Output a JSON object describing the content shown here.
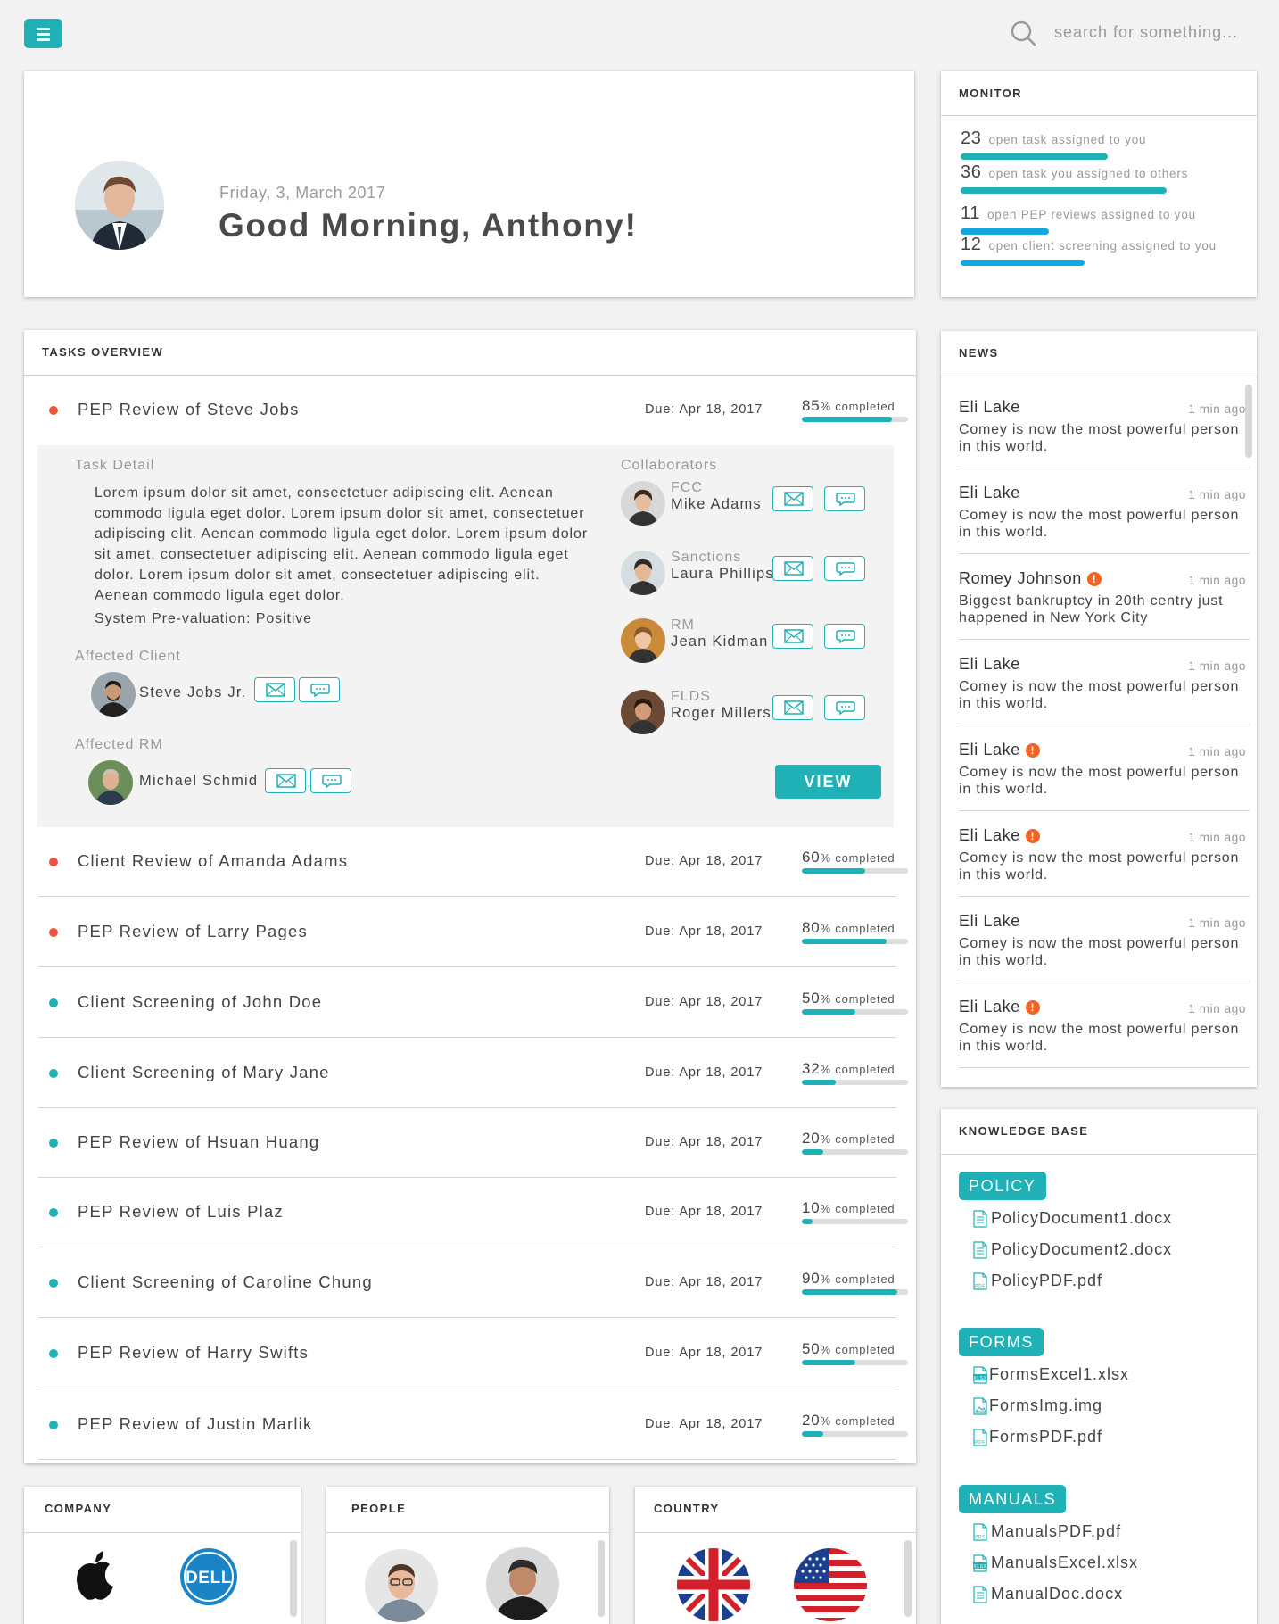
{
  "topbar": {
    "search_placeholder": "search for something..."
  },
  "welcome": {
    "date": "Friday, 3, March 2017",
    "greeting": "Good Morning, Anthony!"
  },
  "monitor": {
    "title": "MONITOR",
    "rows": [
      {
        "count": "23",
        "label": "open task assigned to you",
        "bar_fraction": 0.5
      },
      {
        "count": "36",
        "label": "open task you assigned to others",
        "bar_fraction": 0.7
      },
      {
        "count": "11",
        "label": "open PEP reviews assigned to you",
        "bar_fraction": 0.3
      },
      {
        "count": "12",
        "label": "open client screening assigned to you",
        "bar_fraction": 0.42
      }
    ]
  },
  "tasks": {
    "title": "TASKS OVERVIEW",
    "pct_suffix": "% completed",
    "items": [
      {
        "name": "PEP Review of Steve Jobs",
        "due": "Due: Apr 18, 2017",
        "pct": "85",
        "status": "red"
      },
      {
        "name": "Client Review of Amanda Adams",
        "due": "Due: Apr 18, 2017",
        "pct": "60",
        "status": "red"
      },
      {
        "name": "PEP Review of Larry Pages",
        "due": "Due: Apr 18, 2017",
        "pct": "80",
        "status": "red"
      },
      {
        "name": "Client Screening of John Doe",
        "due": "Due: Apr 18, 2017",
        "pct": "50",
        "status": "teal"
      },
      {
        "name": "Client Screening of Mary Jane",
        "due": "Due: Apr 18, 2017",
        "pct": "32",
        "status": "teal"
      },
      {
        "name": "PEP Review of Hsuan Huang",
        "due": "Due: Apr 18, 2017",
        "pct": "20",
        "status": "teal"
      },
      {
        "name": "PEP Review of Luis Plaz",
        "due": "Due: Apr 18, 2017",
        "pct": "10",
        "status": "teal"
      },
      {
        "name": "Client Screening of Caroline Chung",
        "due": "Due: Apr 18, 2017",
        "pct": "90",
        "status": "teal"
      },
      {
        "name": "PEP Review of Harry Swifts",
        "due": "Due: Apr 18, 2017",
        "pct": "50",
        "status": "teal"
      },
      {
        "name": "PEP Review of Justin Marlik",
        "due": "Due: Apr 18, 2017",
        "pct": "20",
        "status": "teal"
      }
    ],
    "detail": {
      "task_detail_label": "Task Detail",
      "description": "Lorem ipsum dolor sit amet, consectetuer adipiscing elit. Aenean commodo ligula eget dolor. Lorem ipsum dolor sit amet, consectetuer adipiscing elit. Aenean commodo ligula eget dolor. Lorem ipsum dolor sit amet, consectetuer adipiscing elit. Aenean commodo ligula eget dolor. Lorem ipsum dolor sit amet, consectetuer adipiscing elit. Aenean commodo ligula eget dolor.",
      "pre_valuation": "System Pre-valuation: Positive",
      "affected_client_label": "Affected Client",
      "affected_client": "Steve Jobs Jr.",
      "affected_rm_label": "Affected RM",
      "affected_rm": "Michael Schmid",
      "collaborators_label": "Collaborators",
      "collaborators": [
        {
          "role": "FCC",
          "name": "Mike Adams"
        },
        {
          "role": "Sanctions",
          "name": "Laura Phillips"
        },
        {
          "role": "RM",
          "name": "Jean Kidman"
        },
        {
          "role": "FLDS",
          "name": "Roger Millers"
        }
      ],
      "view_label": "VIEW"
    }
  },
  "news": {
    "title": "NEWS",
    "items": [
      {
        "name": "Eli Lake",
        "alert": false,
        "time": "1 min ago",
        "body": "Comey is now the most powerful person in this world."
      },
      {
        "name": "Eli Lake",
        "alert": false,
        "time": "1 min ago",
        "body": "Comey is now the most powerful person in this world."
      },
      {
        "name": "Romey Johnson",
        "alert": true,
        "time": "1 min ago",
        "body": "Biggest bankruptcy in 20th centry just happened in New York City"
      },
      {
        "name": "Eli Lake",
        "alert": false,
        "time": "1 min ago",
        "body": "Comey is now the most powerful person in this world."
      },
      {
        "name": "Eli Lake",
        "alert": true,
        "time": "1 min ago",
        "body": "Comey is now the most powerful person in this world."
      },
      {
        "name": "Eli Lake",
        "alert": true,
        "time": "1 min ago",
        "body": "Comey is now the most powerful person in this world."
      },
      {
        "name": "Eli Lake",
        "alert": false,
        "time": "1 min ago",
        "body": "Comey is now the most powerful person in this world."
      },
      {
        "name": "Eli Lake",
        "alert": true,
        "time": "1 min ago",
        "body": "Comey is now the most powerful person in this world."
      }
    ]
  },
  "knowledge_base": {
    "title": "KNOWLEDGE BASE",
    "sections": [
      {
        "tag": "POLICY",
        "files": [
          {
            "name": "PolicyDocument1.docx",
            "icon": "doc-file-icon"
          },
          {
            "name": "PolicyDocument2.docx",
            "icon": "doc-file-icon"
          },
          {
            "name": "PolicyPDF.pdf",
            "icon": "pdf-file-icon"
          }
        ]
      },
      {
        "tag": "FORMS",
        "files": [
          {
            "name": "FormsExcel1.xlsx",
            "icon": "xlsx-file-icon"
          },
          {
            "name": "FormsImg.img",
            "icon": "image-file-icon"
          },
          {
            "name": "FormsPDF.pdf",
            "icon": "pdf-file-icon"
          }
        ]
      },
      {
        "tag": "MANUALS",
        "files": [
          {
            "name": "ManualsPDF.pdf",
            "icon": "pdf-file-icon"
          },
          {
            "name": "ManualsExcel.xlsx",
            "icon": "xlsx-file-icon"
          },
          {
            "name": "ManualDoc.docx",
            "icon": "doc-file-icon"
          }
        ]
      }
    ]
  },
  "company": {
    "title": "COMPANY",
    "logos": [
      "apple-logo",
      "dell-logo"
    ],
    "dell_text": "DELL"
  },
  "people": {
    "title": "PEOPLE"
  },
  "country": {
    "title": "COUNTRY",
    "flags": [
      "uk-flag",
      "usa-flag"
    ]
  },
  "colors": {
    "accent": "#1fb1b5",
    "monitor_bar": "#13a6e0",
    "red_status": "#f0543c",
    "alert": "#f26522"
  }
}
